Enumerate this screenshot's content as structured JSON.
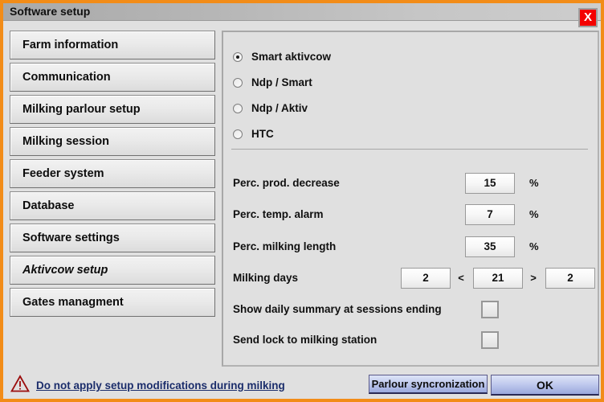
{
  "window": {
    "title": "Software setup",
    "close_label": "X",
    "accent_color": "#f28c18"
  },
  "sidebar": {
    "items": [
      {
        "label": "Farm information",
        "style": "normal"
      },
      {
        "label": "Communication",
        "style": "normal"
      },
      {
        "label": "Milking parlour setup",
        "style": "normal"
      },
      {
        "label": "Milking session",
        "style": "normal"
      },
      {
        "label": "Feeder system",
        "style": "normal"
      },
      {
        "label": "Database",
        "style": "normal"
      },
      {
        "label": "Software settings",
        "style": "normal"
      },
      {
        "label": "Aktivcow setup",
        "style": "italic"
      },
      {
        "label": "Gates managment",
        "style": "normal"
      }
    ]
  },
  "panel": {
    "radio_group": {
      "options": [
        {
          "label": "Smart aktivcow",
          "selected": true
        },
        {
          "label": "Ndp / Smart",
          "selected": false
        },
        {
          "label": "Ndp / Aktiv",
          "selected": false
        },
        {
          "label": "HTC",
          "selected": false
        }
      ]
    },
    "fields": {
      "prod_decrease": {
        "label": "Perc. prod. decrease",
        "value": "15",
        "unit": "%"
      },
      "temp_alarm": {
        "label": "Perc. temp. alarm",
        "value": "7",
        "unit": "%"
      },
      "milking_length": {
        "label": "Perc. milking length",
        "value": "35",
        "unit": "%"
      },
      "milking_days": {
        "label": "Milking days",
        "min_value": "2",
        "left_operator": "<",
        "mid_value": "21",
        "right_operator": ">",
        "max_value": "2"
      }
    },
    "checkboxes": [
      {
        "label": "Show daily summary at sessions ending",
        "checked": false
      },
      {
        "label": "Send lock to milking station",
        "checked": false
      }
    ]
  },
  "footer": {
    "warning_icon": "warning-triangle-icon",
    "warning_text": "Do not apply setup modifications during milking",
    "warning_color": "#1b2d6b",
    "parlour_button": "Parlour syncronization",
    "ok_button": "OK"
  }
}
